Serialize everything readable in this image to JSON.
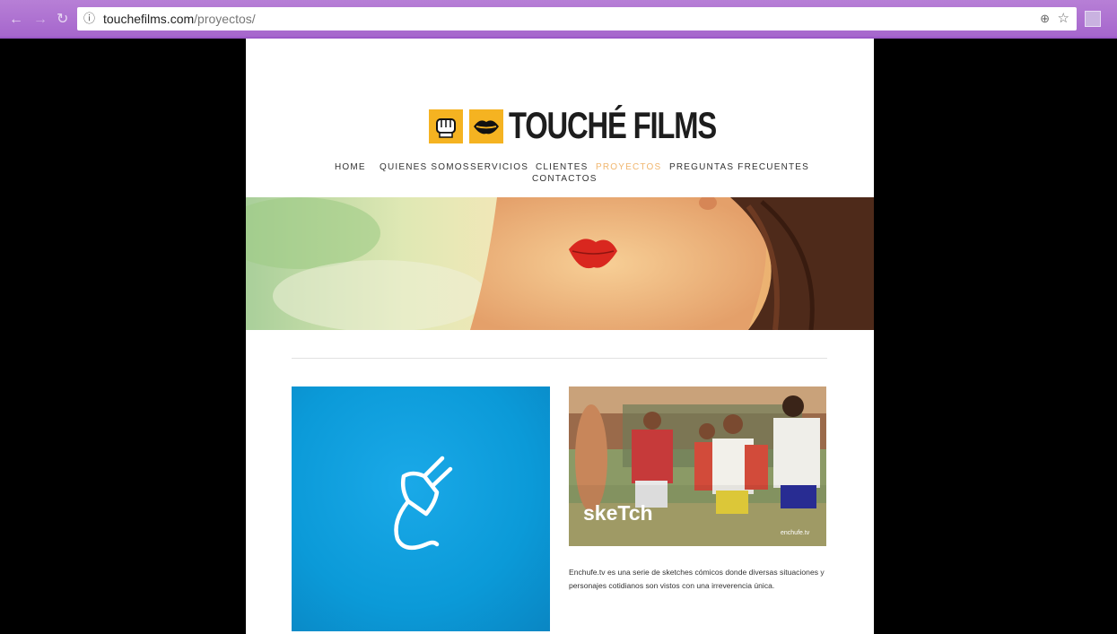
{
  "browser": {
    "url_host": "touchefilms.com",
    "url_path": "/proyectos/",
    "back_icon": "back-arrow-icon",
    "forward_icon": "forward-arrow-icon",
    "reload_icon": "reload-icon",
    "info_icon": "info-icon",
    "zoom_icon": "zoom-icon",
    "star_icon": "star-icon"
  },
  "site": {
    "logo_text": "TOUCHÉ FILMS",
    "nav": [
      "HOME",
      "QUIENES SOMOS",
      "SERVICIOS",
      "CLIENTES",
      "PROYECTOS",
      "PREGUNTAS FRECUENTES",
      "CONTACTOS"
    ],
    "active_nav": "PROYECTOS"
  },
  "projects": [
    {
      "image": "enchufe-plug-logo",
      "color": "#0b9ad8"
    },
    {
      "image": "sketch-photo",
      "overlay_text": "skeTch",
      "watermark": "enchufe.tv",
      "description": "Enchufe.tv es una serie de sketches cómicos donde diversas situaciones y personajes cotidianos son vistos con una irreverencia única."
    }
  ],
  "colors": {
    "accent": "#f0b66e",
    "logo_yellow": "#f5b321",
    "chrome_purple": "#a565cc"
  }
}
